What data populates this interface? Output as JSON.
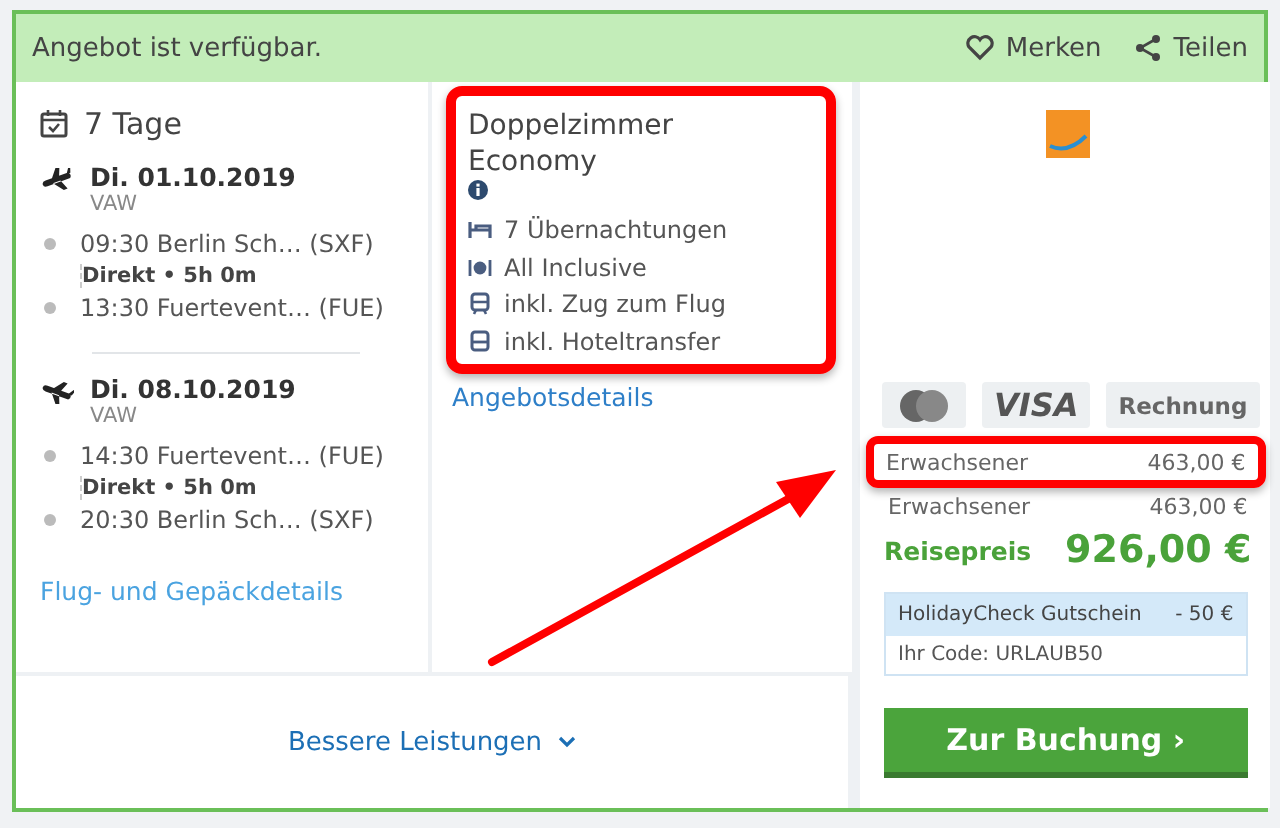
{
  "banner": {
    "text": "Angebot ist verfügbar.",
    "actions": [
      {
        "kind": "heart",
        "label": "Merken"
      },
      {
        "kind": "share",
        "label": "Teilen"
      }
    ]
  },
  "duration": "7 Tage",
  "flights": [
    {
      "kind": "outbound",
      "date": "Di. 01.10.2019",
      "carrier": "VAW",
      "info": "Direkt • 5h 0m",
      "legs": [
        {
          "time": "09:30",
          "place": "Berlin Sch…",
          "code": "(SXF)"
        },
        {
          "time": "13:30",
          "place": "Fuertevent…",
          "code": "(FUE)"
        }
      ]
    },
    {
      "kind": "return",
      "date": "Di. 08.10.2019",
      "carrier": "VAW",
      "info": "Direkt • 5h 0m",
      "legs": [
        {
          "time": "14:30",
          "place": "Fuertevent…",
          "code": "(FUE)"
        },
        {
          "time": "20:30",
          "place": "Berlin Sch…",
          "code": "(SXF)"
        }
      ]
    }
  ],
  "flight_link": "Flug- und Gepäckdetails",
  "room": {
    "title": "Doppelzimmer Economy",
    "highlighted": true,
    "features": [
      {
        "kind": "bed",
        "text": "7 Übernachtungen"
      },
      {
        "kind": "meal",
        "text": "All Inclusive"
      },
      {
        "kind": "train",
        "text": "inkl. Zug zum Flug"
      },
      {
        "kind": "bus",
        "text": "inkl. Hoteltransfer"
      }
    ],
    "link": "Angebotsdetails"
  },
  "payment": [
    {
      "kind": "card"
    },
    {
      "kind": "text",
      "label": "VISA"
    },
    {
      "kind": "text",
      "label": "Rechnung"
    }
  ],
  "prices": [
    {
      "label": "Erwachsener",
      "amount": "463,00 €",
      "highlighted": true
    },
    {
      "label": "Erwachsener",
      "amount": "463,00 €",
      "highlighted": false
    }
  ],
  "total": {
    "label": "Reisepreis",
    "amount": "926,00 €"
  },
  "voucher": {
    "title": "HolidayCheck Gutschein",
    "amount": "- 50 €",
    "code": "Ihr Code: URLAUB50"
  },
  "book_button": "Zur Buchung ›",
  "more_link": "Bessere Leistungen",
  "annotation_arrow": true
}
